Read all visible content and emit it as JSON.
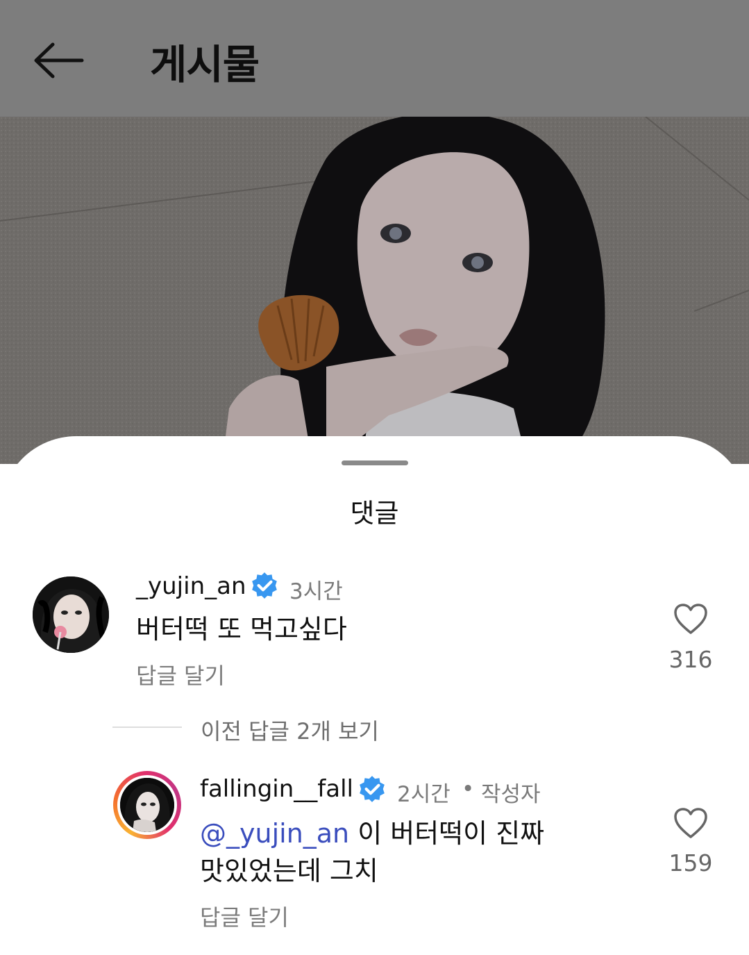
{
  "header": {
    "title": "게시물",
    "back_icon": "arrow-left-icon"
  },
  "sheet": {
    "title": "댓글"
  },
  "comments": [
    {
      "username": "_yujin_an",
      "time": "3시간",
      "text": "버터떡 또 먹고싶다",
      "reply_label": "답글 달기",
      "like_count": "316"
    }
  ],
  "view_previous_replies": "이전 답글 2개 보기",
  "replies": [
    {
      "username": "fallingin__fall",
      "time": "2시간",
      "separator": "•",
      "author_badge": "작성자",
      "mention": "@_yujin_an",
      "text_line1": " 이 버터떡이 진짜",
      "text_line2": "맛있었는데 그치",
      "reply_label": "답글 달기",
      "like_count": "159"
    }
  ],
  "colors": {
    "header_bg": "#7d7d7d",
    "verified": "#3897f0",
    "mention": "#3a4dbd"
  }
}
